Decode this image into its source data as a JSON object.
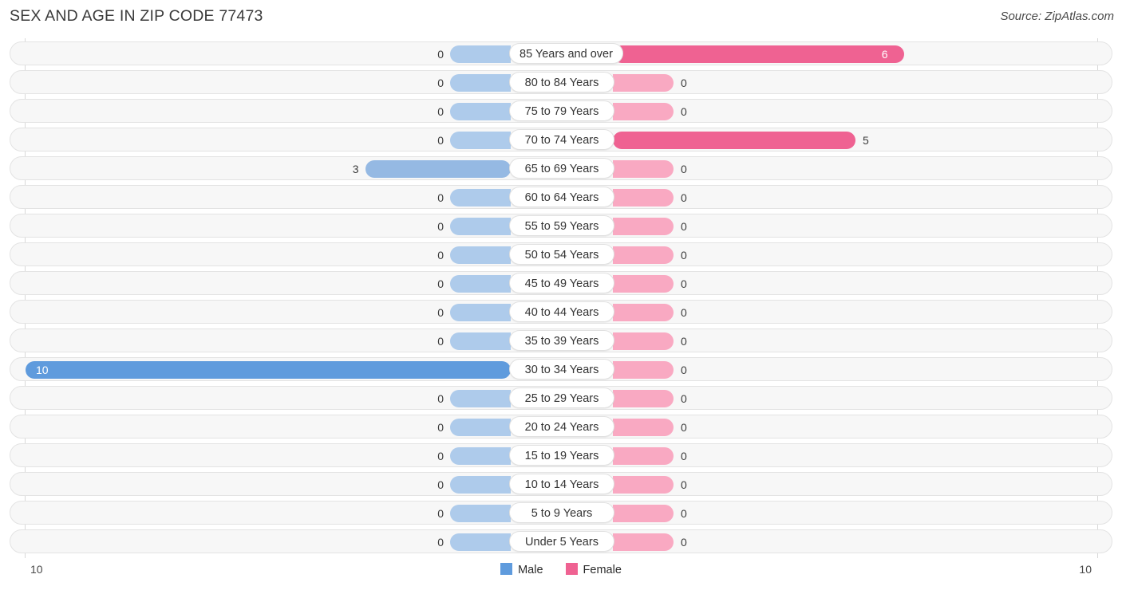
{
  "header": {
    "title": "SEX AND AGE IN ZIP CODE 77473",
    "source": "Source: ZipAtlas.com"
  },
  "legend": {
    "items": [
      {
        "label": "Male",
        "color": "#5f9bdd"
      },
      {
        "label": "Female",
        "color": "#ef6292"
      }
    ]
  },
  "axis": {
    "left_tick": "10",
    "right_tick": "10"
  },
  "colors": {
    "male_strong": "#5f9bdd",
    "male_mid": "#95b9e3",
    "male_light": "#aecbeb",
    "female_strong": "#ef6292",
    "female_light": "#f9a9c2",
    "track": "#f7f7f7",
    "track_border": "#e3e3e3"
  },
  "chart_data": {
    "type": "bar",
    "subtype": "population-pyramid",
    "title": "SEX AND AGE IN ZIP CODE 77473",
    "xlabel": "",
    "ylabel": "",
    "xlim": [
      10,
      10
    ],
    "grid": false,
    "legend_position": "bottom-center",
    "categories": [
      "85 Years and over",
      "80 to 84 Years",
      "75 to 79 Years",
      "70 to 74 Years",
      "65 to 69 Years",
      "60 to 64 Years",
      "55 to 59 Years",
      "50 to 54 Years",
      "45 to 49 Years",
      "40 to 44 Years",
      "35 to 39 Years",
      "30 to 34 Years",
      "25 to 29 Years",
      "20 to 24 Years",
      "15 to 19 Years",
      "10 to 14 Years",
      "5 to 9 Years",
      "Under 5 Years"
    ],
    "series": [
      {
        "name": "Male",
        "values": [
          0,
          0,
          0,
          0,
          3,
          0,
          0,
          0,
          0,
          0,
          0,
          10,
          0,
          0,
          0,
          0,
          0,
          0
        ]
      },
      {
        "name": "Female",
        "values": [
          6,
          0,
          0,
          5,
          0,
          0,
          0,
          0,
          0,
          0,
          0,
          0,
          0,
          0,
          0,
          0,
          0,
          0
        ]
      }
    ]
  }
}
